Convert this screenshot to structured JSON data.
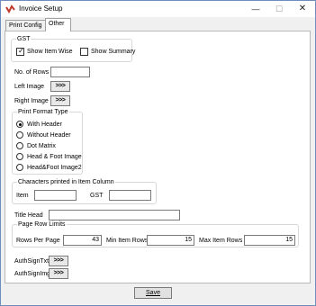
{
  "window": {
    "title": "Invoice Setup",
    "minimize": "—",
    "maximize": "☐",
    "close": "✕"
  },
  "tabs": [
    {
      "label": "Print Config",
      "active": false
    },
    {
      "label": "Other",
      "active": true
    }
  ],
  "gst": {
    "group_label": "GST",
    "show_item_wise": {
      "label": "Show Item Wise",
      "checked": true
    },
    "show_summary": {
      "label": "Show Summary",
      "checked": false
    }
  },
  "fields": {
    "no_of_rows": {
      "label": "No. of Rows",
      "value": ""
    },
    "left_image": {
      "label": "Left Image",
      "button": ">>>"
    },
    "right_image": {
      "label": "Right Image",
      "button": ">>>"
    }
  },
  "print_format": {
    "group_label": "Print Format Type",
    "options": [
      {
        "label": "With Header",
        "selected": true
      },
      {
        "label": "Without Header",
        "selected": false
      },
      {
        "label": "Dot Matrix",
        "selected": false
      },
      {
        "label": "Head & Foot Image",
        "selected": false
      },
      {
        "label": "Head&Foot Image2",
        "selected": false
      }
    ]
  },
  "chars_printed": {
    "group_label": "Characters printed in Item Column",
    "item_label": "Item",
    "item_value": "",
    "gst_label": "GST",
    "gst_value": ""
  },
  "title_head": {
    "label": "Title Head",
    "value": ""
  },
  "page_row_limits": {
    "group_label": "Page Row Limits",
    "rows_per_page": {
      "label": "Rows Per Page",
      "value": "43"
    },
    "min_item_rows": {
      "label": "Min Item Rows",
      "value": "15"
    },
    "max_item_rows": {
      "label": "Max Item Rows",
      "value": "15"
    }
  },
  "auth": {
    "sign_txt": {
      "label": "AuthSignTxt",
      "button": ">>>"
    },
    "sign_img": {
      "label": "AuthSignImg",
      "button": ">>>"
    }
  },
  "save_label": "Save",
  "colors": {
    "accent_border": "#6a8fbd",
    "app_icon": "#c0392b"
  }
}
